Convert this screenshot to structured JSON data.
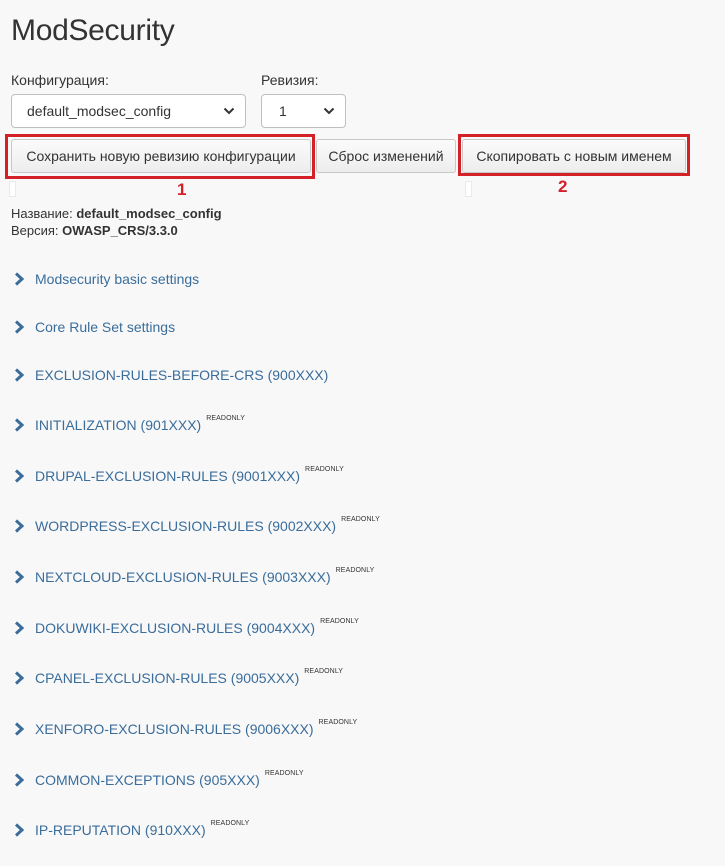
{
  "page": {
    "title": "ModSecurity"
  },
  "form": {
    "config_label": "Конфигурация:",
    "config_value": "default_modsec_config",
    "revision_label": "Ревизия:",
    "revision_value": "1"
  },
  "toolbar": {
    "save_label": "Сохранить новую ревизию конфигурации",
    "reset_label": "Сброс изменений",
    "copy_label": "Скопировать с новым именем"
  },
  "annotations": {
    "marker_1": "1",
    "marker_2": "2",
    "highlight_color": "#d42027"
  },
  "info": {
    "name_label": "Название:",
    "name_value": "default_modsec_config",
    "version_label": "Версия:",
    "version_value": "OWASP_CRS/3.3.0"
  },
  "sections": [
    {
      "label": "Modsecurity basic settings",
      "badge": ""
    },
    {
      "label": "Core Rule Set settings",
      "badge": ""
    },
    {
      "label": "EXCLUSION-RULES-BEFORE-CRS (900XXX)",
      "badge": ""
    },
    {
      "label": "INITIALIZATION (901XXX)",
      "badge": "READONLY"
    },
    {
      "label": "DRUPAL-EXCLUSION-RULES (9001XXX)",
      "badge": "READONLY"
    },
    {
      "label": "WORDPRESS-EXCLUSION-RULES (9002XXX)",
      "badge": "READONLY"
    },
    {
      "label": "NEXTCLOUD-EXCLUSION-RULES (9003XXX)",
      "badge": "READONLY"
    },
    {
      "label": "DOKUWIKI-EXCLUSION-RULES (9004XXX)",
      "badge": "READONLY"
    },
    {
      "label": "CPANEL-EXCLUSION-RULES (9005XXX)",
      "badge": "READONLY"
    },
    {
      "label": "XENFORO-EXCLUSION-RULES (9006XXX)",
      "badge": "READONLY"
    },
    {
      "label": "COMMON-EXCEPTIONS (905XXX)",
      "badge": "READONLY"
    },
    {
      "label": "IP-REPUTATION (910XXX)",
      "badge": "READONLY"
    }
  ],
  "colors": {
    "link": "#3a6d9a",
    "accent": "#d42027",
    "background": "#f8f8f9"
  }
}
